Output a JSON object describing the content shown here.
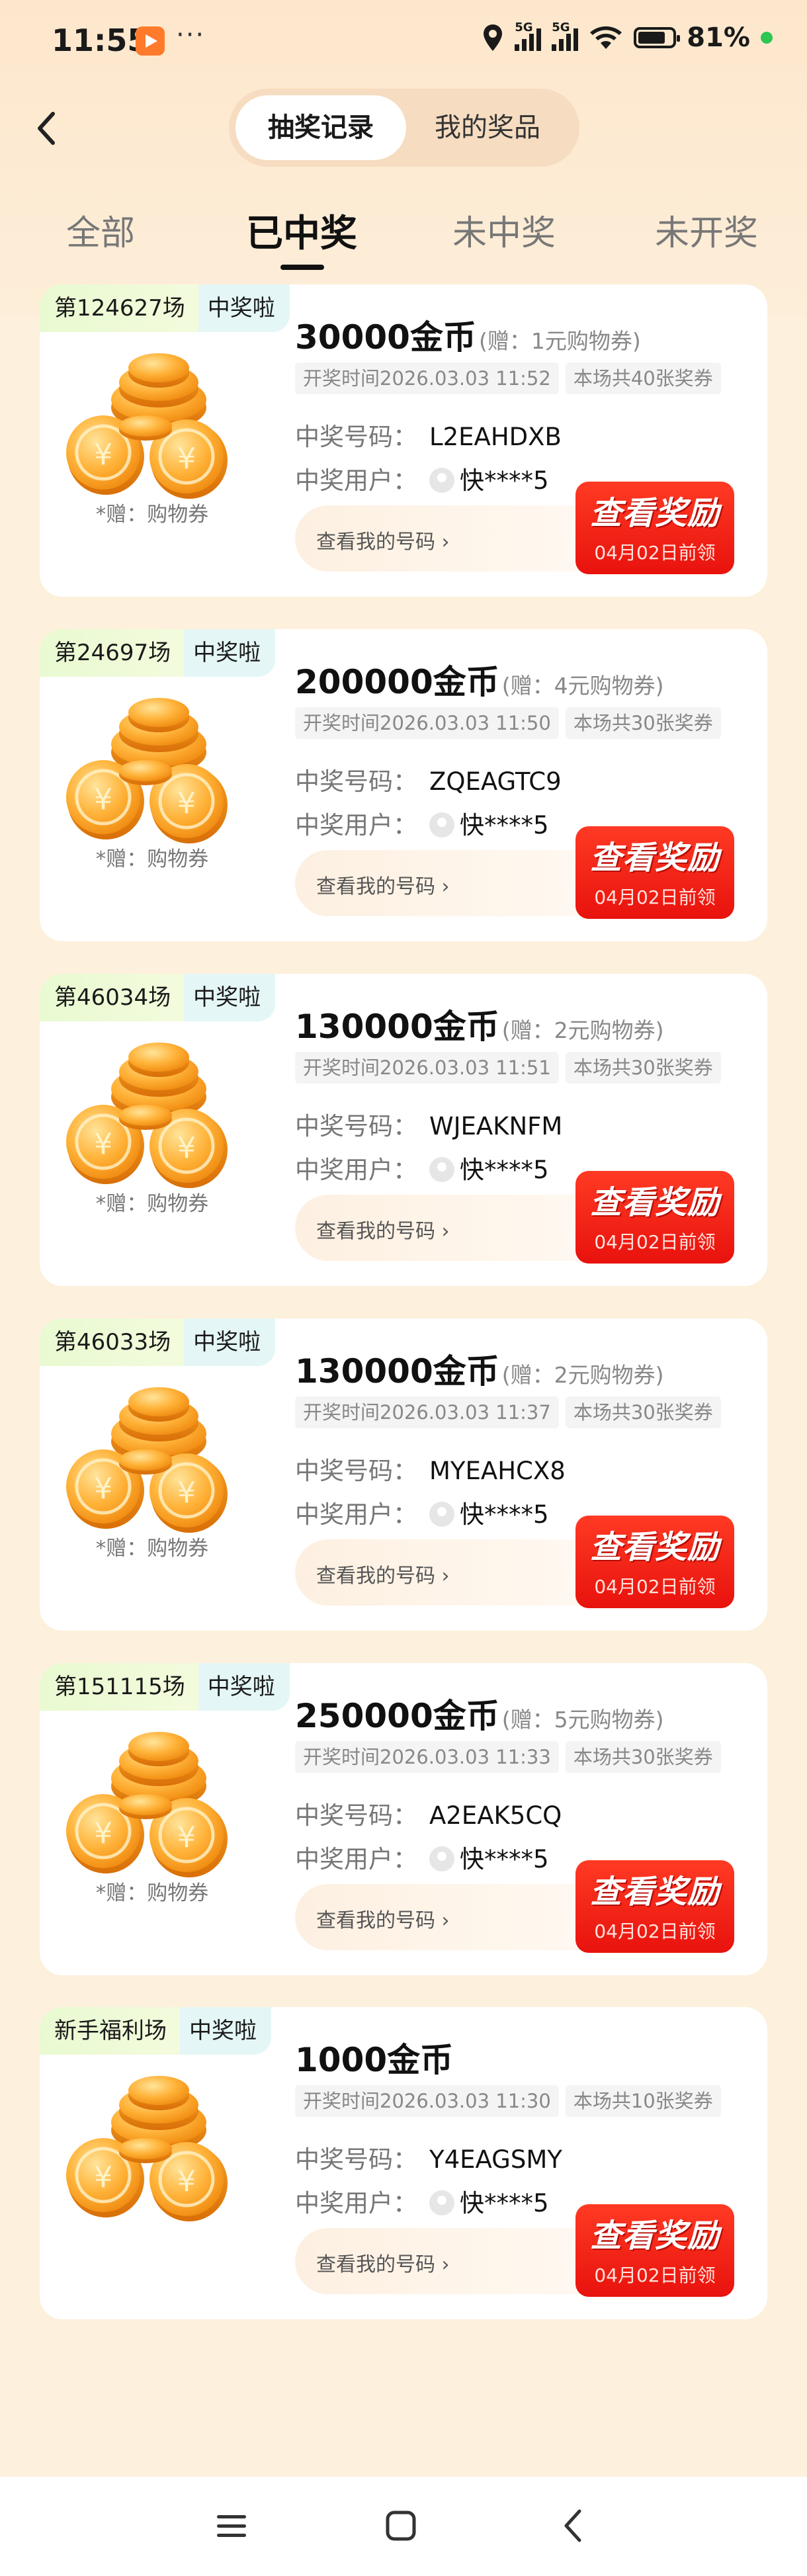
{
  "status_bar": {
    "time": "11:55",
    "more": "···",
    "network1": "5G",
    "network2": "5G",
    "battery": "81%"
  },
  "header": {
    "segments": [
      "抽奖记录",
      "我的奖品"
    ]
  },
  "tabs": [
    "全部",
    "已中奖",
    "未中奖",
    "未开奖"
  ],
  "cards": [
    {
      "round": "第124627场",
      "badge": "中奖啦",
      "amount": "30000金币",
      "gift": "(赠：1元购物券)",
      "draw_time": "开奖时间2026.03.03 11:52",
      "tickets": "本场共40张奖券",
      "code_label": "中奖号码：",
      "code": "L2EAHDXB",
      "user_label": "中奖用户：",
      "user": "快****5",
      "gift_note": "*赠：购物券",
      "mycode": "查看我的号码 ›",
      "reward": "查看奖励",
      "deadline": "04月02日前领"
    },
    {
      "round": "第24697场",
      "badge": "中奖啦",
      "amount": "200000金币",
      "gift": "(赠：4元购物券)",
      "draw_time": "开奖时间2026.03.03 11:50",
      "tickets": "本场共30张奖券",
      "code_label": "中奖号码：",
      "code": "ZQEAGTC9",
      "user_label": "中奖用户：",
      "user": "快****5",
      "gift_note": "*赠：购物券",
      "mycode": "查看我的号码 ›",
      "reward": "查看奖励",
      "deadline": "04月02日前领"
    },
    {
      "round": "第46034场",
      "badge": "中奖啦",
      "amount": "130000金币",
      "gift": "(赠：2元购物券)",
      "draw_time": "开奖时间2026.03.03 11:51",
      "tickets": "本场共30张奖券",
      "code_label": "中奖号码：",
      "code": "WJEAKNFM",
      "user_label": "中奖用户：",
      "user": "快****5",
      "gift_note": "*赠：购物券",
      "mycode": "查看我的号码 ›",
      "reward": "查看奖励",
      "deadline": "04月02日前领"
    },
    {
      "round": "第46033场",
      "badge": "中奖啦",
      "amount": "130000金币",
      "gift": "(赠：2元购物券)",
      "draw_time": "开奖时间2026.03.03 11:37",
      "tickets": "本场共30张奖券",
      "code_label": "中奖号码：",
      "code": "MYEAHCX8",
      "user_label": "中奖用户：",
      "user": "快****5",
      "gift_note": "*赠：购物券",
      "mycode": "查看我的号码 ›",
      "reward": "查看奖励",
      "deadline": "04月02日前领"
    },
    {
      "round": "第151115场",
      "badge": "中奖啦",
      "amount": "250000金币",
      "gift": "(赠：5元购物券)",
      "draw_time": "开奖时间2026.03.03 11:33",
      "tickets": "本场共30张奖券",
      "code_label": "中奖号码：",
      "code": "A2EAK5CQ",
      "user_label": "中奖用户：",
      "user": "快****5",
      "gift_note": "*赠：购物券",
      "mycode": "查看我的号码 ›",
      "reward": "查看奖励",
      "deadline": "04月02日前领"
    },
    {
      "round": "新手福利场",
      "badge": "中奖啦",
      "amount": "1000金币",
      "gift": "",
      "draw_time": "开奖时间2026.03.03 11:30",
      "tickets": "本场共10张奖券",
      "code_label": "中奖号码：",
      "code": "Y4EAGSMY",
      "user_label": "中奖用户：",
      "user": "快****5",
      "gift_note": "",
      "mycode": "查看我的号码 ›",
      "reward": "查看奖励",
      "deadline": "04月02日前领"
    }
  ],
  "nav": {
    "icons": [
      "menu-icon",
      "home-square-icon",
      "back-triangle-icon"
    ]
  }
}
